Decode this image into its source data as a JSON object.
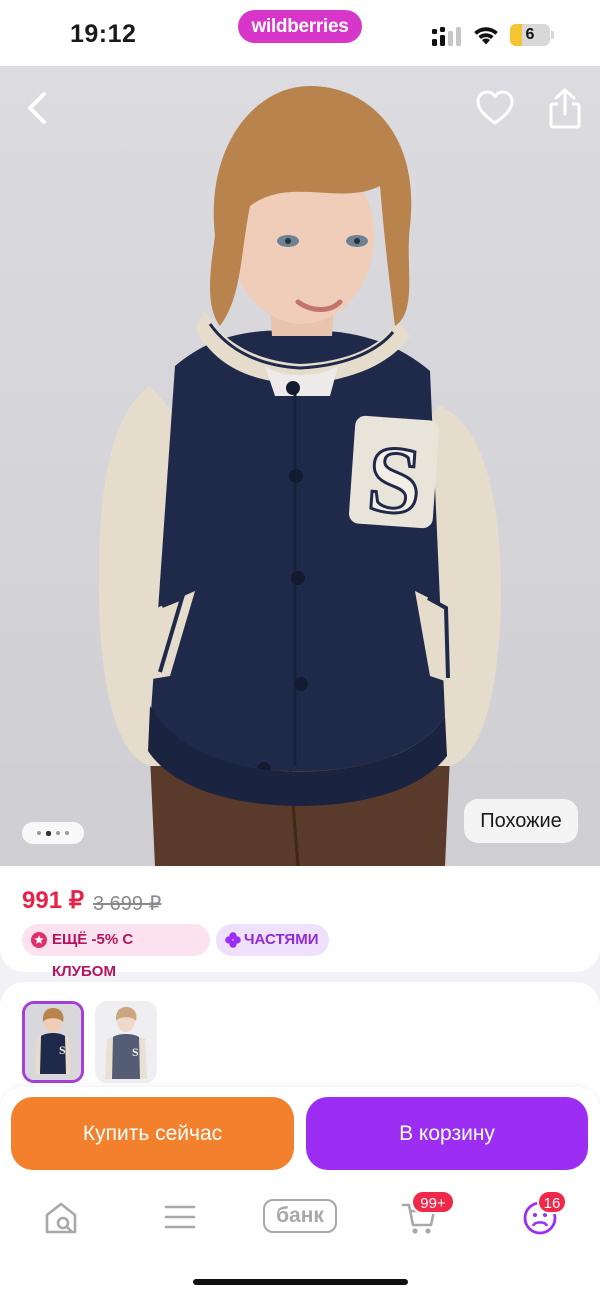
{
  "status_bar": {
    "time": "19:12",
    "brand": "wildberries",
    "battery": "6"
  },
  "product": {
    "photo_alt": "Бомбер с нашивкой S",
    "similar_label": "Похожие",
    "carousel": {
      "total": 4,
      "active": 2
    }
  },
  "price": {
    "current": "991 ₽",
    "old": "3 699 ₽",
    "badges": {
      "club": "ЕЩЁ -5% С КЛУБОМ",
      "parts": "ЧАСТЯМИ"
    }
  },
  "actions": {
    "buy_now": "Купить сейчас",
    "add_to_cart": "В корзину"
  },
  "tab_bar": {
    "bank_label": "банк",
    "cart_badge": "99+",
    "profile_badge": "16"
  },
  "colors": {
    "brand": "#d836c8",
    "price": "#e8214a",
    "buy": "#f2802c",
    "cart": "#9b2ef2",
    "badge": "#f0284a"
  },
  "icons": {
    "back": "chevron-left-icon",
    "favorite": "heart-icon",
    "share": "share-icon",
    "home": "home-search-icon",
    "catalog": "menu-icon",
    "cart": "cart-icon",
    "profile": "profile-icon"
  }
}
